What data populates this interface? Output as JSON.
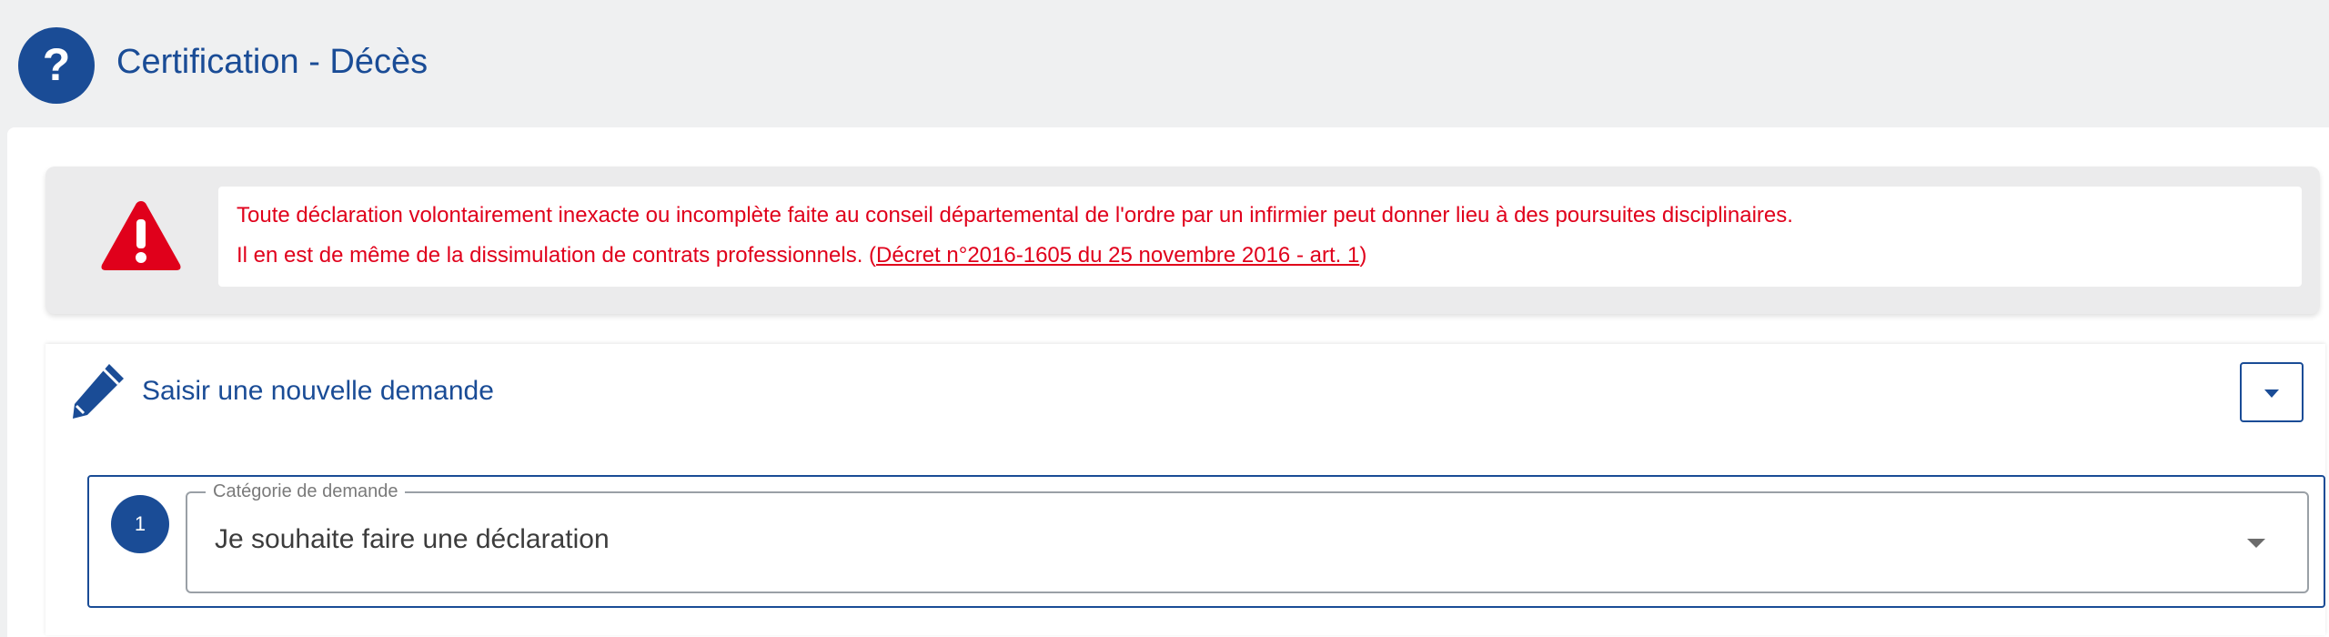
{
  "header": {
    "title": "Certification - Décès",
    "help_icon": "question-mark-icon",
    "accent_color": "#1a4c96"
  },
  "warning": {
    "icon": "warning-triangle-icon",
    "color": "#e0001b",
    "line1": "Toute déclaration volontairement inexacte ou incomplète faite au conseil départemental de l'ordre par un infirmier peut donner lieu à des poursuites disciplinaires.",
    "line2_prefix": "Il en est de même de la dissimulation de contrats professionnels. (",
    "line2_link": "Décret n°2016-1605 du 25 novembre 2016 - art. 1",
    "line2_suffix": ")"
  },
  "request_panel": {
    "icon": "pencil-icon",
    "title": "Saisir une nouvelle demande",
    "toggle_icon": "caret-down-icon"
  },
  "step": {
    "number": "1",
    "field_label": "Catégorie de demande",
    "field_value": "Je souhaite faire une déclaration"
  }
}
